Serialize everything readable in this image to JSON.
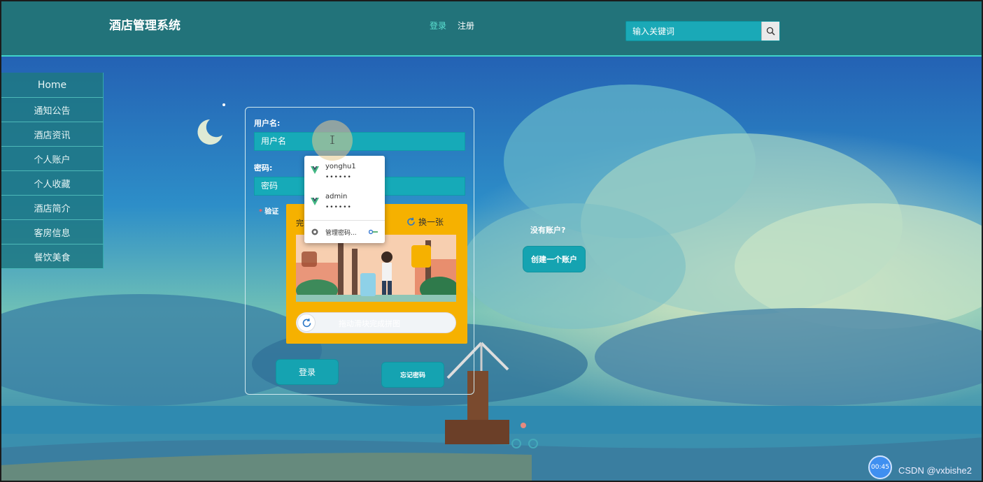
{
  "header": {
    "title": "酒店管理系统",
    "nav_login": "登录",
    "nav_register": "注册",
    "search_placeholder": "输入关键词"
  },
  "sidebar": {
    "items": [
      {
        "label": "Home"
      },
      {
        "label": "通知公告"
      },
      {
        "label": "酒店资讯"
      },
      {
        "label": "个人账户"
      },
      {
        "label": "个人收藏"
      },
      {
        "label": "酒店简介"
      },
      {
        "label": "客房信息"
      },
      {
        "label": "餐饮美食"
      }
    ]
  },
  "login": {
    "username_label": "用户名:",
    "username_value": "用户名",
    "password_label": "密码:",
    "password_value": "密码",
    "verify_label": "验证",
    "login_button": "登录",
    "forgot_button": "忘记密码"
  },
  "captcha": {
    "title": "完",
    "refresh_label": "换一张",
    "slider_hint": "拖动滑块完成拼图"
  },
  "autocomplete": {
    "entries": [
      {
        "user": "yonghu1",
        "password_mask": "••••••"
      },
      {
        "user": "admin",
        "password_mask": "••••••"
      }
    ],
    "manage_label": "管理密码..."
  },
  "signup": {
    "prompt": "没有账户?",
    "button": "创建一个账户"
  },
  "overlay": {
    "timer": "00:45",
    "watermark": "CSDN @vxbishe2"
  },
  "colors": {
    "header_bg": "#22737a",
    "accent": "#15a3b1",
    "captcha_bg": "#f6b100"
  }
}
